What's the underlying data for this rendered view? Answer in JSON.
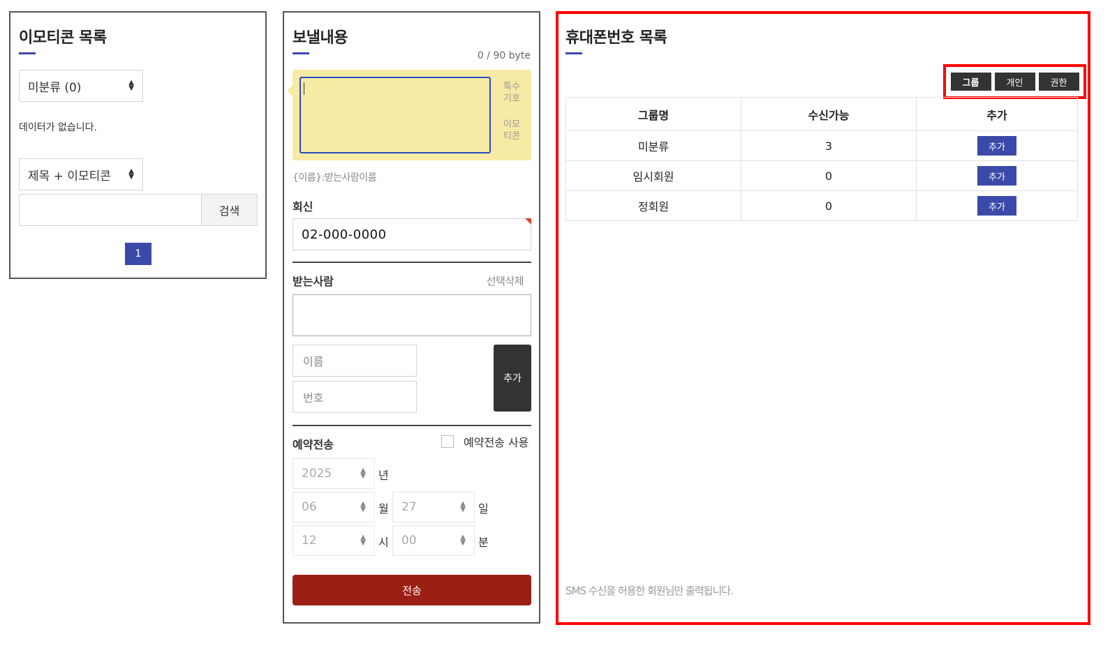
{
  "emoticon_panel": {
    "title": "이모티콘 목록",
    "category_select": "미분류 (0)",
    "no_data": "데이터가 없습니다.",
    "search_type_select": "제목 + 이모티콘",
    "search_input": "",
    "search_button": "검색",
    "pagination": [
      "1"
    ]
  },
  "message_panel": {
    "title": "보낼내용",
    "byte_counter": "0 / 90 byte",
    "message_text": "",
    "special_char_link": [
      "특수",
      "기호"
    ],
    "emoticon_link": [
      "이모",
      "티콘"
    ],
    "name_hint": "{이름}:받는사람이름",
    "reply_label": "회신",
    "reply_number": "02-000-0000",
    "recipient_label": "받는사람",
    "delete_selected": "선택삭제",
    "name_placeholder": "이름",
    "number_placeholder": "번호",
    "add_button": "추가",
    "reserve_label": "예약전송",
    "reserve_checkbox_label": "예약전송 사용",
    "reserve_checked": false,
    "year": "2025",
    "year_unit": "년",
    "month": "06",
    "month_unit": "월",
    "day": "27",
    "day_unit": "일",
    "hour": "12",
    "hour_unit": "시",
    "minute": "00",
    "minute_unit": "분",
    "send_button": "전송"
  },
  "phone_panel": {
    "title": "휴대폰번호 목록",
    "tabs": [
      {
        "label": "그룹",
        "active": true
      },
      {
        "label": "개인",
        "active": false
      },
      {
        "label": "권한",
        "active": false
      }
    ],
    "columns": [
      "그룹명",
      "수신가능",
      "추가"
    ],
    "rows": [
      {
        "group": "미분류",
        "count": "3",
        "action": "추가"
      },
      {
        "group": "임시회원",
        "count": "0",
        "action": "추가"
      },
      {
        "group": "정회원",
        "count": "0",
        "action": "추가"
      }
    ],
    "footnote": "SMS 수신을 허용한 회원님만 출력됩니다."
  },
  "colors": {
    "accent_blue": "#3b4aa8",
    "send_red": "#9b1f14",
    "highlight_red": "#ff0000",
    "message_yellow": "#f7eaa4"
  }
}
